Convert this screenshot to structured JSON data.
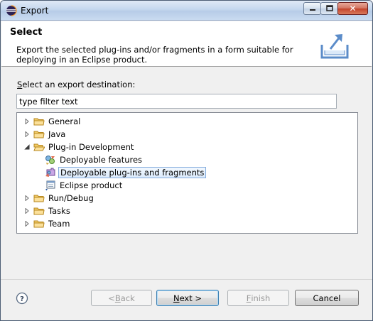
{
  "window": {
    "title": "Export"
  },
  "header": {
    "title": "Select",
    "description": "Export the selected plug-ins and/or fragments in a form suitable for deploying in an Eclipse product."
  },
  "destination": {
    "label_accesskey": "S",
    "label_rest": "elect an export destination:",
    "filter_value": "type filter text"
  },
  "tree": {
    "items": [
      {
        "label": "General",
        "icon": "folder-icon",
        "expanded": false
      },
      {
        "label": "Java",
        "icon": "folder-icon",
        "expanded": false
      },
      {
        "label": "Plug-in Development",
        "icon": "folder-open-icon",
        "expanded": true
      },
      {
        "label": "Deployable features",
        "icon": "feature-icon"
      },
      {
        "label": "Deployable plug-ins and fragments",
        "icon": "plugin-icon",
        "selected": true
      },
      {
        "label": "Eclipse product",
        "icon": "product-icon"
      },
      {
        "label": "Run/Debug",
        "icon": "folder-icon",
        "expanded": false
      },
      {
        "label": "Tasks",
        "icon": "folder-icon",
        "expanded": false
      },
      {
        "label": "Team",
        "icon": "folder-icon",
        "expanded": false
      }
    ]
  },
  "buttons": {
    "back_prefix": "< ",
    "back_accesskey": "B",
    "back_rest": "ack",
    "next_accesskey": "N",
    "next_rest": "ext >",
    "finish_accesskey": "F",
    "finish_rest": "inish",
    "cancel": "Cancel"
  },
  "colors": {
    "selection_border": "#84acdd",
    "folder": "#e8b84a",
    "titlebar": "#c5d7ee"
  }
}
